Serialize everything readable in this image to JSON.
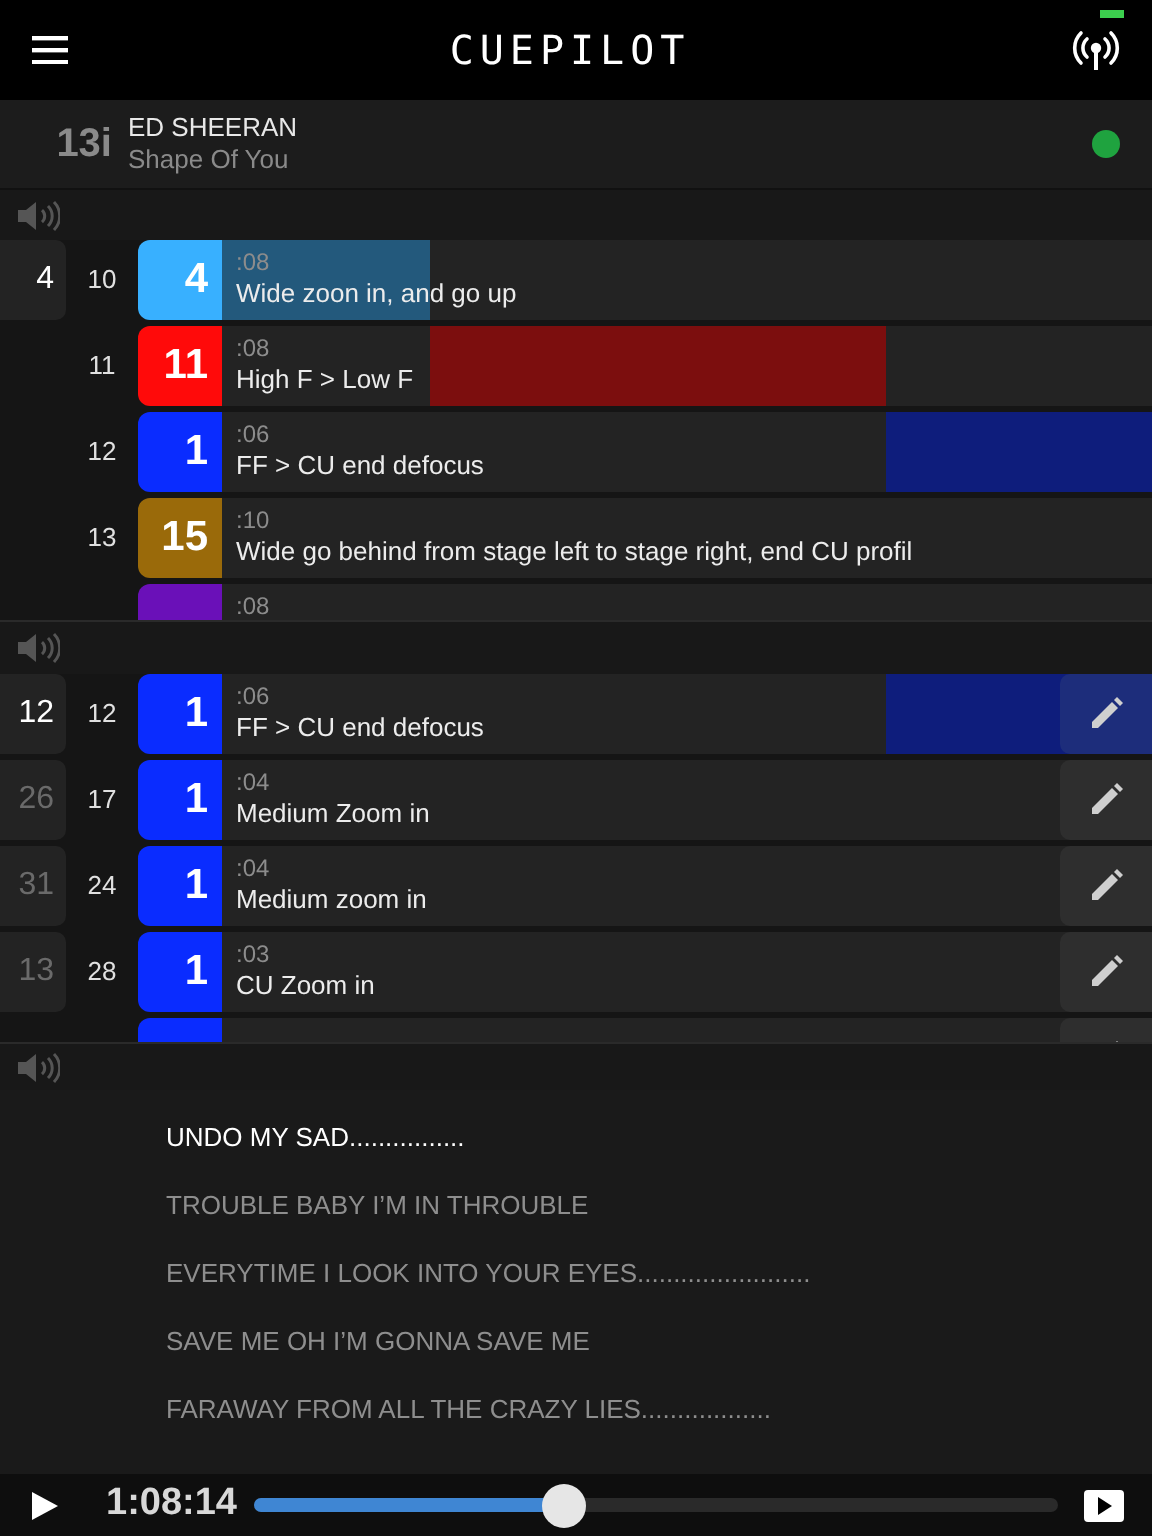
{
  "app_bar": {
    "title": "CUEPILOT"
  },
  "song": {
    "number": "13i",
    "artist": "ED SHEERAN",
    "title": "Shape Of You",
    "connected": true
  },
  "timeline_section": {
    "rows": [
      {
        "kind": "cue",
        "shot": {
          "text": "4",
          "selected": true
        },
        "number": "10",
        "camera": "4",
        "color": "#38b0ff",
        "duration": ":08",
        "description": "Wide zoon in, and go up",
        "level": 0.224
      },
      {
        "kind": "cue",
        "number": "11",
        "camera": "11",
        "color": "#ff0a0a",
        "duration": ":08",
        "description": "High F > Low F",
        "level": 0.49
      },
      {
        "kind": "cue",
        "number": "12",
        "camera": "1",
        "color": "#0a2cff",
        "duration": ":06",
        "description": "FF > CU end defocus",
        "level": 0.286
      },
      {
        "kind": "cue",
        "number": "13",
        "camera": "15",
        "color": "#9a6a0a",
        "duration": ":10",
        "description": "Wide go behind from stage left to stage right, end CU profil"
      },
      {
        "kind": "partial",
        "color": "#6a10b8",
        "duration": ":08"
      }
    ]
  },
  "camera_section": {
    "rows": [
      {
        "kind": "cue",
        "shot": {
          "text": "12",
          "selected": true
        },
        "number": "12",
        "camera": "1",
        "color": "#0a2cff",
        "duration": ":06",
        "description": "FF > CU end defocus",
        "level": 0.286
      },
      {
        "kind": "cue",
        "shot": {
          "text": "26",
          "selected": false
        },
        "number": "17",
        "camera": "1",
        "color": "#0a2cff",
        "duration": ":04",
        "description": "Medium Zoom in"
      },
      {
        "kind": "cue",
        "shot": {
          "text": "31",
          "selected": false
        },
        "number": "24",
        "camera": "1",
        "color": "#0a2cff",
        "duration": ":04",
        "description": "Medium zoom in"
      },
      {
        "kind": "cue",
        "shot": {
          "text": "13",
          "selected": false
        },
        "number": "28",
        "camera": "1",
        "color": "#0a2cff",
        "duration": ":03",
        "description": "CU Zoom in"
      },
      {
        "kind": "partial",
        "color": "#0a2cff"
      }
    ]
  },
  "lyrics": [
    {
      "text": "UNDO MY SAD................",
      "selected": true
    },
    {
      "text": "TROUBLE BABY I’M IN THROUBLE",
      "selected": false
    },
    {
      "text": "EVERYTIME I LOOK INTO YOUR EYES........................",
      "selected": false
    },
    {
      "text": "SAVE ME OH I’M GONNA SAVE ME",
      "selected": false
    },
    {
      "text": "FARAWAY FROM ALL THE CRAZY LIES..................",
      "selected": false
    }
  ],
  "player": {
    "time": "1:08:14",
    "level": 0.387
  }
}
